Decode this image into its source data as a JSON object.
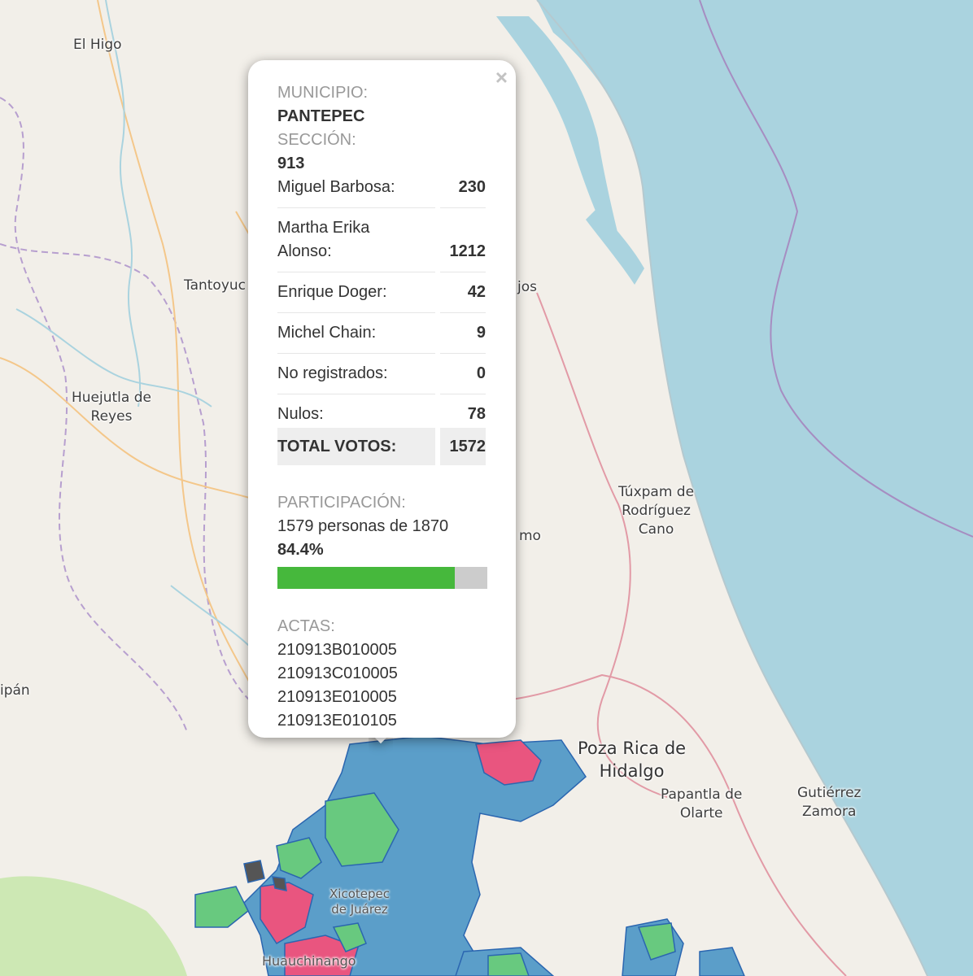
{
  "map": {
    "places": [
      {
        "name": "El Higo"
      },
      {
        "name": "Tantoyuc"
      },
      {
        "name": "jos"
      },
      {
        "name": "Huejutla de\nReyes"
      },
      {
        "name": "Túxpam de\nRodríguez\nCano"
      },
      {
        "name": "mo"
      },
      {
        "name": "ipán"
      },
      {
        "name": "Poza Rica de\nHidalgo"
      },
      {
        "name": "Papantla de\nOlarte"
      },
      {
        "name": "Gutiérrez\nZamora"
      },
      {
        "name": "Xicotepec\nde Juárez"
      },
      {
        "name": "Huauchinango"
      }
    ],
    "colors": {
      "water": "#aad3df",
      "land": "#f2efe9",
      "blue": "#5b9ec9",
      "pink": "#e9557f",
      "green": "#68c97f",
      "gray": "#555555"
    }
  },
  "popup": {
    "close_label": "×",
    "municipio_label": "MUNICIPIO:",
    "municipio": "PANTEPEC",
    "seccion_label": "SECCIÓN:",
    "seccion": "913",
    "results": [
      {
        "name": "Miguel Barbosa:",
        "votes": "230"
      },
      {
        "name": "Martha Erika Alonso:",
        "votes": "1212"
      },
      {
        "name": "Enrique Doger:",
        "votes": "42"
      },
      {
        "name": "Michel Chain:",
        "votes": "9"
      },
      {
        "name": "No registrados:",
        "votes": "0"
      },
      {
        "name": "Nulos:",
        "votes": "78"
      }
    ],
    "total_label": "TOTAL VOTOS:",
    "total": "1572",
    "participacion_label": "PARTICIPACIÓN:",
    "participacion_text": "1579 personas de 1870",
    "participacion_pct": "84.4%",
    "participacion_fraction": 0.844,
    "actas_label": "ACTAS:",
    "actas": [
      "210913B010005",
      "210913C010005",
      "210913E010005",
      "210913E010105"
    ],
    "bar_fill_color": "#46b83c"
  }
}
